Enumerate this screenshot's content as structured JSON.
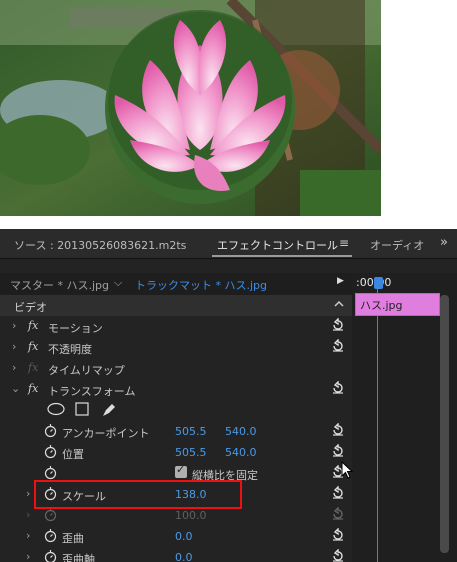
{
  "tabs": {
    "source": "ソース : 20130526083621.m2ts",
    "effect_controls": "エフェクトコントロール",
    "menu_icon": "≡",
    "audio": "オーディオ",
    "overflow": "»"
  },
  "source_bar": {
    "master": "マスター * ハス.jpg",
    "chevron": "⌵",
    "track": "トラックマット * ハス.jpg"
  },
  "timeline": {
    "play": "▶",
    "timecode": ":00:00",
    "clip_name": "ハス.jpg"
  },
  "rows": {
    "video": "ビデオ",
    "motion": "モーション",
    "opacity": "不透明度",
    "time_remap": "タイムリマップ",
    "transform": "トランスフォーム",
    "anchor": {
      "label": "アンカーポイント",
      "x": "505.5",
      "y": "540.0"
    },
    "position": {
      "label": "位置",
      "x": "505.5",
      "y": "540.0"
    },
    "uniform_scale": "縦横比を固定",
    "scale": {
      "label": "スケール",
      "value": "138.0"
    },
    "scale_width": {
      "value": "100.0"
    },
    "skew": {
      "label": "歪曲",
      "value": "0.0"
    },
    "skew_axis": {
      "label": "歪曲軸",
      "value": "0.0"
    }
  },
  "icons": {
    "fx": "fx",
    "chevron_right": "›",
    "chevron_down": "⌄"
  },
  "colors": {
    "value_blue": "#4a9ae8",
    "clip_pink": "#e07ee0",
    "highlight_red": "#e11111"
  }
}
